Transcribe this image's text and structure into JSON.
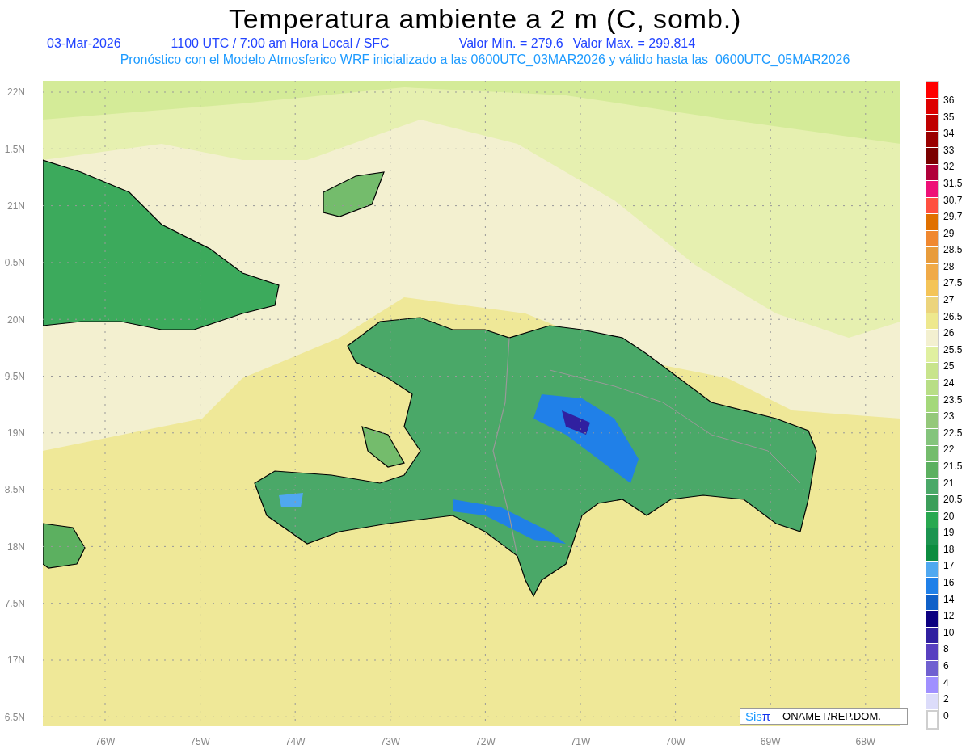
{
  "title": "Temperatura ambiente a 2 m (C, somb.)",
  "info_line": {
    "date": "03-Mar-2026",
    "time": "1100 UTC / 7:00 am Hora Local / SFC",
    "min": "Valor Min. = 279.6",
    "max": "Valor Max. = 299.814"
  },
  "model_line": "Pronóstico con el Modelo Atmosferico WRF inicializado a las 0600UTC_03MAR2026 y válido hasta las  0600UTC_05MAR2026",
  "lat_labels": [
    "22N",
    "1.5N",
    "21N",
    "0.5N",
    "20N",
    "9.5N",
    "19N",
    "8.5N",
    "18N",
    "7.5N",
    "17N",
    "6.5N"
  ],
  "lon_labels": [
    "76W",
    "75W",
    "74W",
    "73W",
    "72W",
    "71W",
    "70W",
    "69W",
    "68W"
  ],
  "colorbar": {
    "segments": [
      {
        "color": "#ff0000"
      },
      {
        "color": "#dd0000"
      },
      {
        "color": "#bf0000"
      },
      {
        "color": "#9a0000"
      },
      {
        "color": "#7a0000"
      },
      {
        "color": "#b0003a"
      },
      {
        "color": "#ee1077"
      },
      {
        "color": "#ff5040"
      },
      {
        "color": "#e07000"
      },
      {
        "color": "#f08830"
      },
      {
        "color": "#e89c3c"
      },
      {
        "color": "#f0aa48"
      },
      {
        "color": "#f4c458"
      },
      {
        "color": "#ecd47c"
      },
      {
        "color": "#eee88e"
      },
      {
        "color": "#f3f0d0"
      },
      {
        "color": "#e0f0a0"
      },
      {
        "color": "#c8e48c"
      },
      {
        "color": "#b8de86"
      },
      {
        "color": "#a4d87a"
      },
      {
        "color": "#94c87a"
      },
      {
        "color": "#84c47c"
      },
      {
        "color": "#74bc6c"
      },
      {
        "color": "#5cb060"
      },
      {
        "color": "#4aa868"
      },
      {
        "color": "#3c9e5a"
      },
      {
        "color": "#28a850"
      },
      {
        "color": "#1c9450"
      },
      {
        "color": "#0c8c40"
      },
      {
        "color": "#50a8f0"
      },
      {
        "color": "#2080e8"
      },
      {
        "color": "#1060c8"
      },
      {
        "color": "#0c0080"
      },
      {
        "color": "#3020a0"
      },
      {
        "color": "#5840c0"
      },
      {
        "color": "#7060d0"
      },
      {
        "color": "#a090ff"
      },
      {
        "color": "#dcdcfa"
      },
      {
        "color": "#ffffff"
      }
    ],
    "labels": [
      "36",
      "35",
      "34",
      "33",
      "32",
      "31.5",
      "30.7",
      "29.7",
      "29",
      "28.5",
      "28",
      "27.5",
      "27",
      "26.5",
      "26",
      "25.5",
      "25",
      "24",
      "23.5",
      "23",
      "22.5",
      "22",
      "21.5",
      "21",
      "20.5",
      "20",
      "19",
      "18",
      "17",
      "16",
      "14",
      "12",
      "10",
      "8",
      "6",
      "4",
      "2",
      "0"
    ]
  },
  "credit": {
    "logo_prefix": "Sis",
    "logo_symbol": "π",
    "text": "– ONAMET/REP.DOM."
  }
}
